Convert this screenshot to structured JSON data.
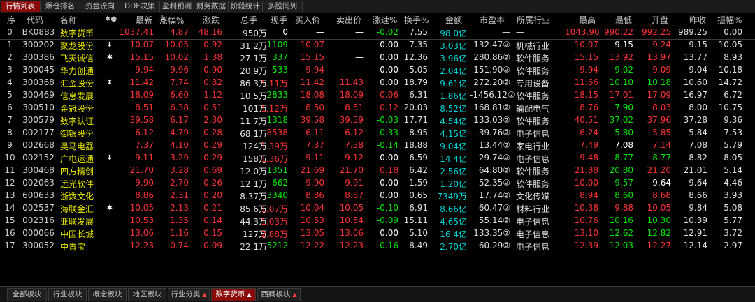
{
  "tabs": [
    "行情列表",
    "爆仓排名",
    "资金流向",
    "DDE决策",
    "盈利预测",
    "财务数据",
    "阶段统计",
    "多股同列"
  ],
  "columns": {
    "seq": "序",
    "code": "代码",
    "name": "名称",
    "marks": "✱●",
    "price": "最新",
    "pct": "涨幅%",
    "chg": "涨跌",
    "vol": "总手",
    "cur": "现手",
    "bid": "买入价",
    "ask": "卖出价",
    "speed": "涨速%",
    "turn": "换手%",
    "amount": "金额",
    "pe": "市盈率",
    "industry": "所属行业",
    "high": "最高",
    "low": "最低",
    "open": "开盘",
    "prev": "昨收",
    "amp": "振幅%"
  },
  "colors": {
    "up": "#ff3232",
    "down": "#00e600",
    "flat": "#ffffff",
    "yellow": "#e8e800",
    "cyan": "#00d0d0",
    "name": "#e8e800",
    "active_tab": "#8a0a0a"
  },
  "rows": [
    {
      "seq": "0",
      "code": "BK0883",
      "name": "数字货币",
      "mark": "",
      "price": "1037.41",
      "pct": "4.87",
      "chg": "48.16",
      "vol": "950万",
      "cur": "0",
      "bid": "—",
      "ask": "—",
      "speed": "-0.02",
      "turn": "7.55",
      "amount": "98.0亿",
      "pe": "—",
      "industry": "—",
      "high": "1043.90",
      "low": "990.22",
      "open": "992.25",
      "prev": "989.25",
      "amp": "0.00"
    },
    {
      "seq": "1",
      "code": "300202",
      "name": "聚龙股份",
      "mark": "⬍",
      "price": "10.07",
      "pct": "10.05",
      "chg": "0.92",
      "vol": "31.2万",
      "cur": "1109",
      "bid": "10.07",
      "ask": "—",
      "speed": "0.00",
      "turn": "7.35",
      "amount": "3.03亿",
      "pe": "132.47②",
      "industry": "机械行业",
      "high": "10.07",
      "low": "9.15",
      "open": "9.24",
      "prev": "9.15",
      "amp": "10.05"
    },
    {
      "seq": "2",
      "code": "300386",
      "name": "飞天诚信",
      "mark": "✱",
      "price": "15.15",
      "pct": "10.02",
      "chg": "1.38",
      "vol": "27.1万",
      "cur": "337",
      "bid": "15.15",
      "ask": "—",
      "speed": "0.00",
      "turn": "12.36",
      "amount": "3.96亿",
      "pe": "280.86②",
      "industry": "软件服务",
      "high": "15.15",
      "low": "13.92",
      "open": "13.97",
      "prev": "13.77",
      "amp": "8.93"
    },
    {
      "seq": "3",
      "code": "300045",
      "name": "华力创通",
      "mark": "",
      "price": "9.94",
      "pct": "9.96",
      "chg": "0.90",
      "vol": "20.9万",
      "cur": "533",
      "bid": "9.94",
      "ask": "—",
      "speed": "0.00",
      "turn": "5.05",
      "amount": "2.04亿",
      "pe": "151.90②",
      "industry": "软件服务",
      "high": "9.94",
      "low": "9.02",
      "open": "9.09",
      "prev": "9.04",
      "amp": "10.18"
    },
    {
      "seq": "4",
      "code": "300368",
      "name": "汇金股份",
      "mark": "⬍",
      "price": "11.42",
      "pct": "7.74",
      "chg": "0.82",
      "vol": "86.3万",
      "cur": "1.11万",
      "bid": "11.42",
      "ask": "11.43",
      "speed": "0.00",
      "turn": "18.79",
      "amount": "9.61亿",
      "pe": "272.20②",
      "industry": "专用设备",
      "high": "11.66",
      "low": "10.10",
      "open": "10.18",
      "prev": "10.60",
      "amp": "14.72"
    },
    {
      "seq": "5",
      "code": "300469",
      "name": "信息发展",
      "mark": "",
      "price": "18.09",
      "pct": "6.60",
      "chg": "1.12",
      "vol": "10.5万",
      "cur": "2833",
      "bid": "18.08",
      "ask": "18.09",
      "speed": "0.06",
      "turn": "6.31",
      "amount": "1.86亿",
      "pe": "-1456.12②",
      "industry": "软件服务",
      "high": "18.15",
      "low": "17.01",
      "open": "17.09",
      "prev": "16.97",
      "amp": "6.72"
    },
    {
      "seq": "6",
      "code": "300510",
      "name": "金冠股份",
      "mark": "",
      "price": "8.51",
      "pct": "6.38",
      "chg": "0.51",
      "vol": "101万",
      "cur": "1.12万",
      "bid": "8.50",
      "ask": "8.51",
      "speed": "0.12",
      "turn": "20.03",
      "amount": "8.52亿",
      "pe": "168.81②",
      "industry": "输配电气",
      "high": "8.76",
      "low": "7.90",
      "open": "8.03",
      "prev": "8.00",
      "amp": "10.75"
    },
    {
      "seq": "7",
      "code": "300579",
      "name": "数字认证",
      "mark": "",
      "price": "39.58",
      "pct": "6.17",
      "chg": "2.30",
      "vol": "11.7万",
      "cur": "1318",
      "bid": "39.58",
      "ask": "39.59",
      "speed": "-0.03",
      "turn": "17.71",
      "amount": "4.54亿",
      "pe": "133.03②",
      "industry": "软件服务",
      "high": "40.51",
      "low": "37.02",
      "open": "37.96",
      "prev": "37.28",
      "amp": "9.36"
    },
    {
      "seq": "8",
      "code": "002177",
      "name": "御银股份",
      "mark": "",
      "price": "6.12",
      "pct": "4.79",
      "chg": "0.28",
      "vol": "68.1万",
      "cur": "8538",
      "bid": "6.11",
      "ask": "6.12",
      "speed": "-0.33",
      "turn": "8.95",
      "amount": "4.15亿",
      "pe": "39.76②",
      "industry": "电子信息",
      "high": "6.24",
      "low": "5.80",
      "open": "5.85",
      "prev": "5.84",
      "amp": "7.53"
    },
    {
      "seq": "9",
      "code": "002668",
      "name": "奥马电器",
      "mark": "",
      "price": "7.37",
      "pct": "4.10",
      "chg": "0.29",
      "vol": "124万",
      "cur": "1.39万",
      "bid": "7.37",
      "ask": "7.38",
      "speed": "-0.14",
      "turn": "18.88",
      "amount": "9.04亿",
      "pe": "13.44②",
      "industry": "家电行业",
      "high": "7.49",
      "low": "7.08",
      "open": "7.14",
      "prev": "7.08",
      "amp": "5.79"
    },
    {
      "seq": "10",
      "code": "002152",
      "name": "广电运通",
      "mark": "⬍",
      "price": "9.11",
      "pct": "3.29",
      "chg": "0.29",
      "vol": "158万",
      "cur": "1.36万",
      "bid": "9.11",
      "ask": "9.12",
      "speed": "0.00",
      "turn": "6.59",
      "amount": "14.4亿",
      "pe": "29.74②",
      "industry": "电子信息",
      "high": "9.48",
      "low": "8.77",
      "open": "8.77",
      "prev": "8.82",
      "amp": "8.05"
    },
    {
      "seq": "11",
      "code": "300468",
      "name": "四方精创",
      "mark": "",
      "price": "21.70",
      "pct": "3.28",
      "chg": "0.69",
      "vol": "12.0万",
      "cur": "1351",
      "bid": "21.69",
      "ask": "21.70",
      "speed": "0.18",
      "turn": "6.42",
      "amount": "2.56亿",
      "pe": "64.80②",
      "industry": "软件服务",
      "high": "21.88",
      "low": "20.80",
      "open": "21.20",
      "prev": "21.01",
      "amp": "5.14"
    },
    {
      "seq": "12",
      "code": "002063",
      "name": "远光软件",
      "mark": "",
      "price": "9.90",
      "pct": "2.70",
      "chg": "0.26",
      "vol": "12.1万",
      "cur": "662",
      "bid": "9.90",
      "ask": "9.91",
      "speed": "0.00",
      "turn": "1.59",
      "amount": "1.20亿",
      "pe": "52.35②",
      "industry": "软件服务",
      "high": "10.00",
      "low": "9.57",
      "open": "9.64",
      "prev": "9.64",
      "amp": "4.46"
    },
    {
      "seq": "13",
      "code": "600633",
      "name": "浙数文化",
      "mark": "",
      "price": "8.86",
      "pct": "2.31",
      "chg": "0.20",
      "vol": "8.37万",
      "cur": "3340",
      "bid": "8.86",
      "ask": "8.87",
      "speed": "0.00",
      "turn": "0.65",
      "amount": "7349万",
      "pe": "17.74②",
      "industry": "文化传媒",
      "high": "8.94",
      "low": "8.60",
      "open": "8.68",
      "prev": "8.66",
      "amp": "3.93"
    },
    {
      "seq": "14",
      "code": "002537",
      "name": "海联金汇",
      "mark": "✱",
      "price": "10.05",
      "pct": "2.13",
      "chg": "0.21",
      "vol": "85.6万",
      "cur": "1.07万",
      "bid": "10.04",
      "ask": "10.05",
      "speed": "-0.10",
      "turn": "6.91",
      "amount": "8.66亿",
      "pe": "60.47②",
      "industry": "材料行业",
      "high": "10.38",
      "low": "9.88",
      "open": "10.05",
      "prev": "9.84",
      "amp": "5.08"
    },
    {
      "seq": "15",
      "code": "002316",
      "name": "亚联发展",
      "mark": "",
      "price": "10.53",
      "pct": "1.35",
      "chg": "0.14",
      "vol": "44.3万",
      "cur": "1.03万",
      "bid": "10.53",
      "ask": "10.54",
      "speed": "-0.09",
      "turn": "15.11",
      "amount": "4.65亿",
      "pe": "55.14②",
      "industry": "电子信息",
      "high": "10.76",
      "low": "10.16",
      "open": "10.30",
      "prev": "10.39",
      "amp": "5.77"
    },
    {
      "seq": "16",
      "code": "000066",
      "name": "中国长城",
      "mark": "",
      "price": "13.06",
      "pct": "1.16",
      "chg": "0.15",
      "vol": "127万",
      "cur": "2.88万",
      "bid": "13.05",
      "ask": "13.06",
      "speed": "0.00",
      "turn": "5.10",
      "amount": "16.4亿",
      "pe": "133.35②",
      "industry": "电子信息",
      "high": "13.10",
      "low": "12.62",
      "open": "12.82",
      "prev": "12.91",
      "amp": "3.72"
    },
    {
      "seq": "17",
      "code": "300052",
      "name": "中青宝",
      "mark": "",
      "price": "12.23",
      "pct": "0.74",
      "chg": "0.09",
      "vol": "22.1万",
      "cur": "5212",
      "bid": "12.22",
      "ask": "12.23",
      "speed": "-0.16",
      "turn": "8.49",
      "amount": "2.70亿",
      "pe": "60.29②",
      "industry": "电子信息",
      "high": "12.39",
      "low": "12.03",
      "open": "12.27",
      "prev": "12.14",
      "amp": "2.97"
    }
  ],
  "bottom_tabs": [
    {
      "label": "全部板块",
      "caret": ""
    },
    {
      "label": "行业板块",
      "caret": ""
    },
    {
      "label": "概念板块",
      "caret": ""
    },
    {
      "label": "地区板块",
      "caret": ""
    },
    {
      "label": "行业分类",
      "caret": "▲"
    },
    {
      "label": "数字货币",
      "caret": "▲"
    },
    {
      "label": "西藏板块",
      "caret": "▲"
    }
  ]
}
